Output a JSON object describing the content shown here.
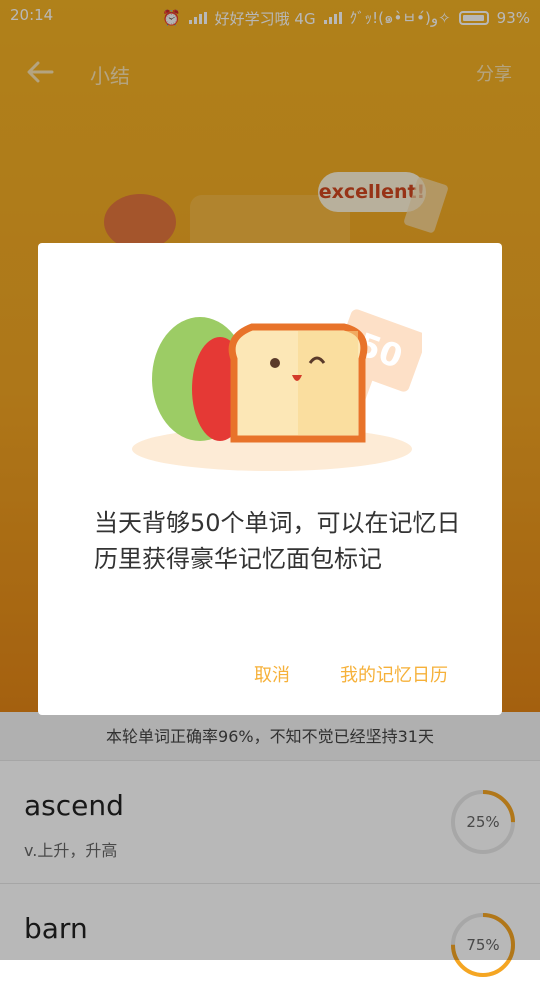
{
  "status_bar": {
    "time": "20:14",
    "carrier": "好好学习哦 4G",
    "extra": "ｸﾞｯ!(๑•̀ㅂ•́)و✧",
    "battery": "93%"
  },
  "app_bar": {
    "title": "小结",
    "share": "分享",
    "back_icon": "back-arrow-icon"
  },
  "hero": {
    "badge": "excellent!"
  },
  "summary_text": "本轮单词正确率96%，不知不觉已经坚持31天",
  "words": [
    {
      "word": "ascend",
      "definition": "v.上升，升高",
      "progress": "25%",
      "progress_value": 0.25
    },
    {
      "word": "barn",
      "definition": "",
      "progress": "75%",
      "progress_value": 0.75
    }
  ],
  "dialog": {
    "illustration": "toast-bread-icon",
    "sign": "50",
    "message": "当天背够50个单词，可以在记忆日历里获得豪华记忆面包标记",
    "cancel": "取消",
    "confirm": "我的记忆日历"
  },
  "colors": {
    "accent": "#f6b13a",
    "hero_top": "#f4b325",
    "hero_bottom": "#e48616",
    "progress": "#f5a623"
  }
}
